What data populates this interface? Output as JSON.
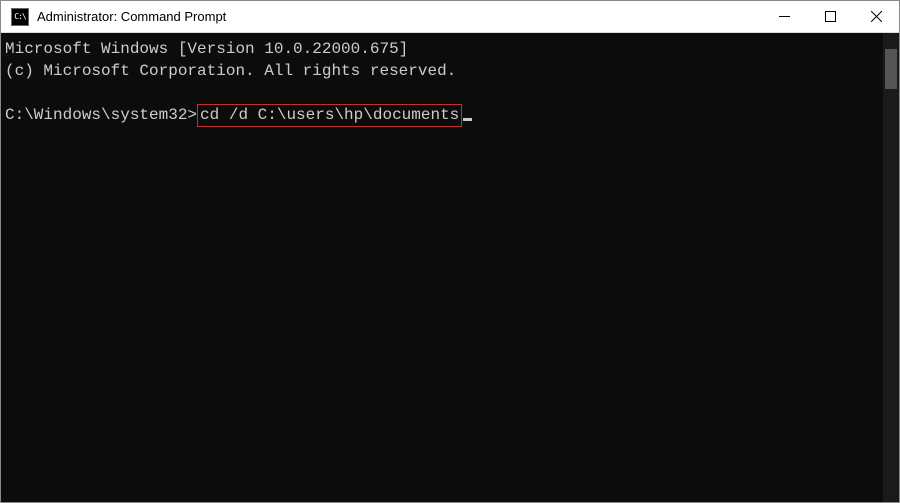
{
  "window": {
    "title": "Administrator: Command Prompt",
    "icon_text": "C:\\"
  },
  "terminal": {
    "banner_line1": "Microsoft Windows [Version 10.0.22000.675]",
    "banner_line2": "(c) Microsoft Corporation. All rights reserved.",
    "prompt": "C:\\Windows\\system32>",
    "command": "cd /d C:\\users\\hp\\documents"
  }
}
